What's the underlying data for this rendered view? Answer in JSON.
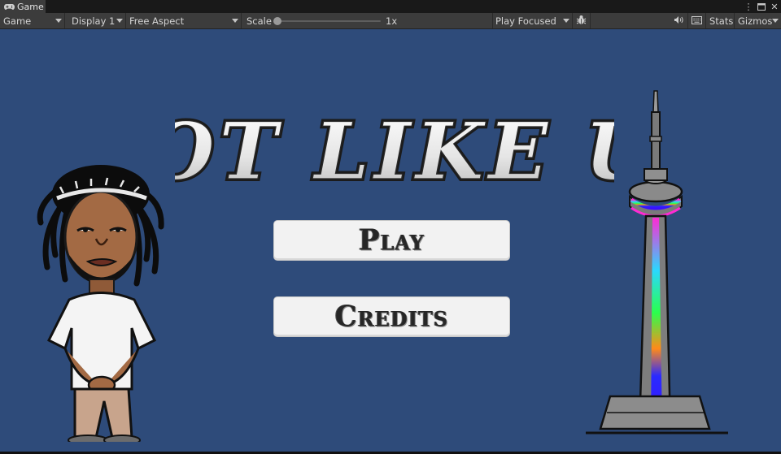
{
  "window": {
    "tab_title": "Game",
    "tab_icon": "gamepad-icon",
    "controls": {
      "more": "⋮",
      "maximize": "□",
      "close": "✕"
    }
  },
  "toolbar": {
    "view_mode": "Game",
    "display": "Display 1",
    "aspect": "Free Aspect",
    "scale_label": "Scale",
    "scale_value": "1x",
    "scale_fraction": 0,
    "play_mode": "Play Focused",
    "bug_icon": "bug-icon",
    "audio_icon": "speaker-icon",
    "grid_icon": "keyboard-icon",
    "stats_label": "Stats",
    "gizmos_label": "Gizmos"
  },
  "game": {
    "title_text": "NOT LIKE US",
    "buttons": {
      "play": "Play",
      "credits": "Credits"
    },
    "background_color": "#2e4b7a",
    "character_icon": "rapper-character-illustration",
    "tower_icon": "cn-tower-illustration"
  }
}
